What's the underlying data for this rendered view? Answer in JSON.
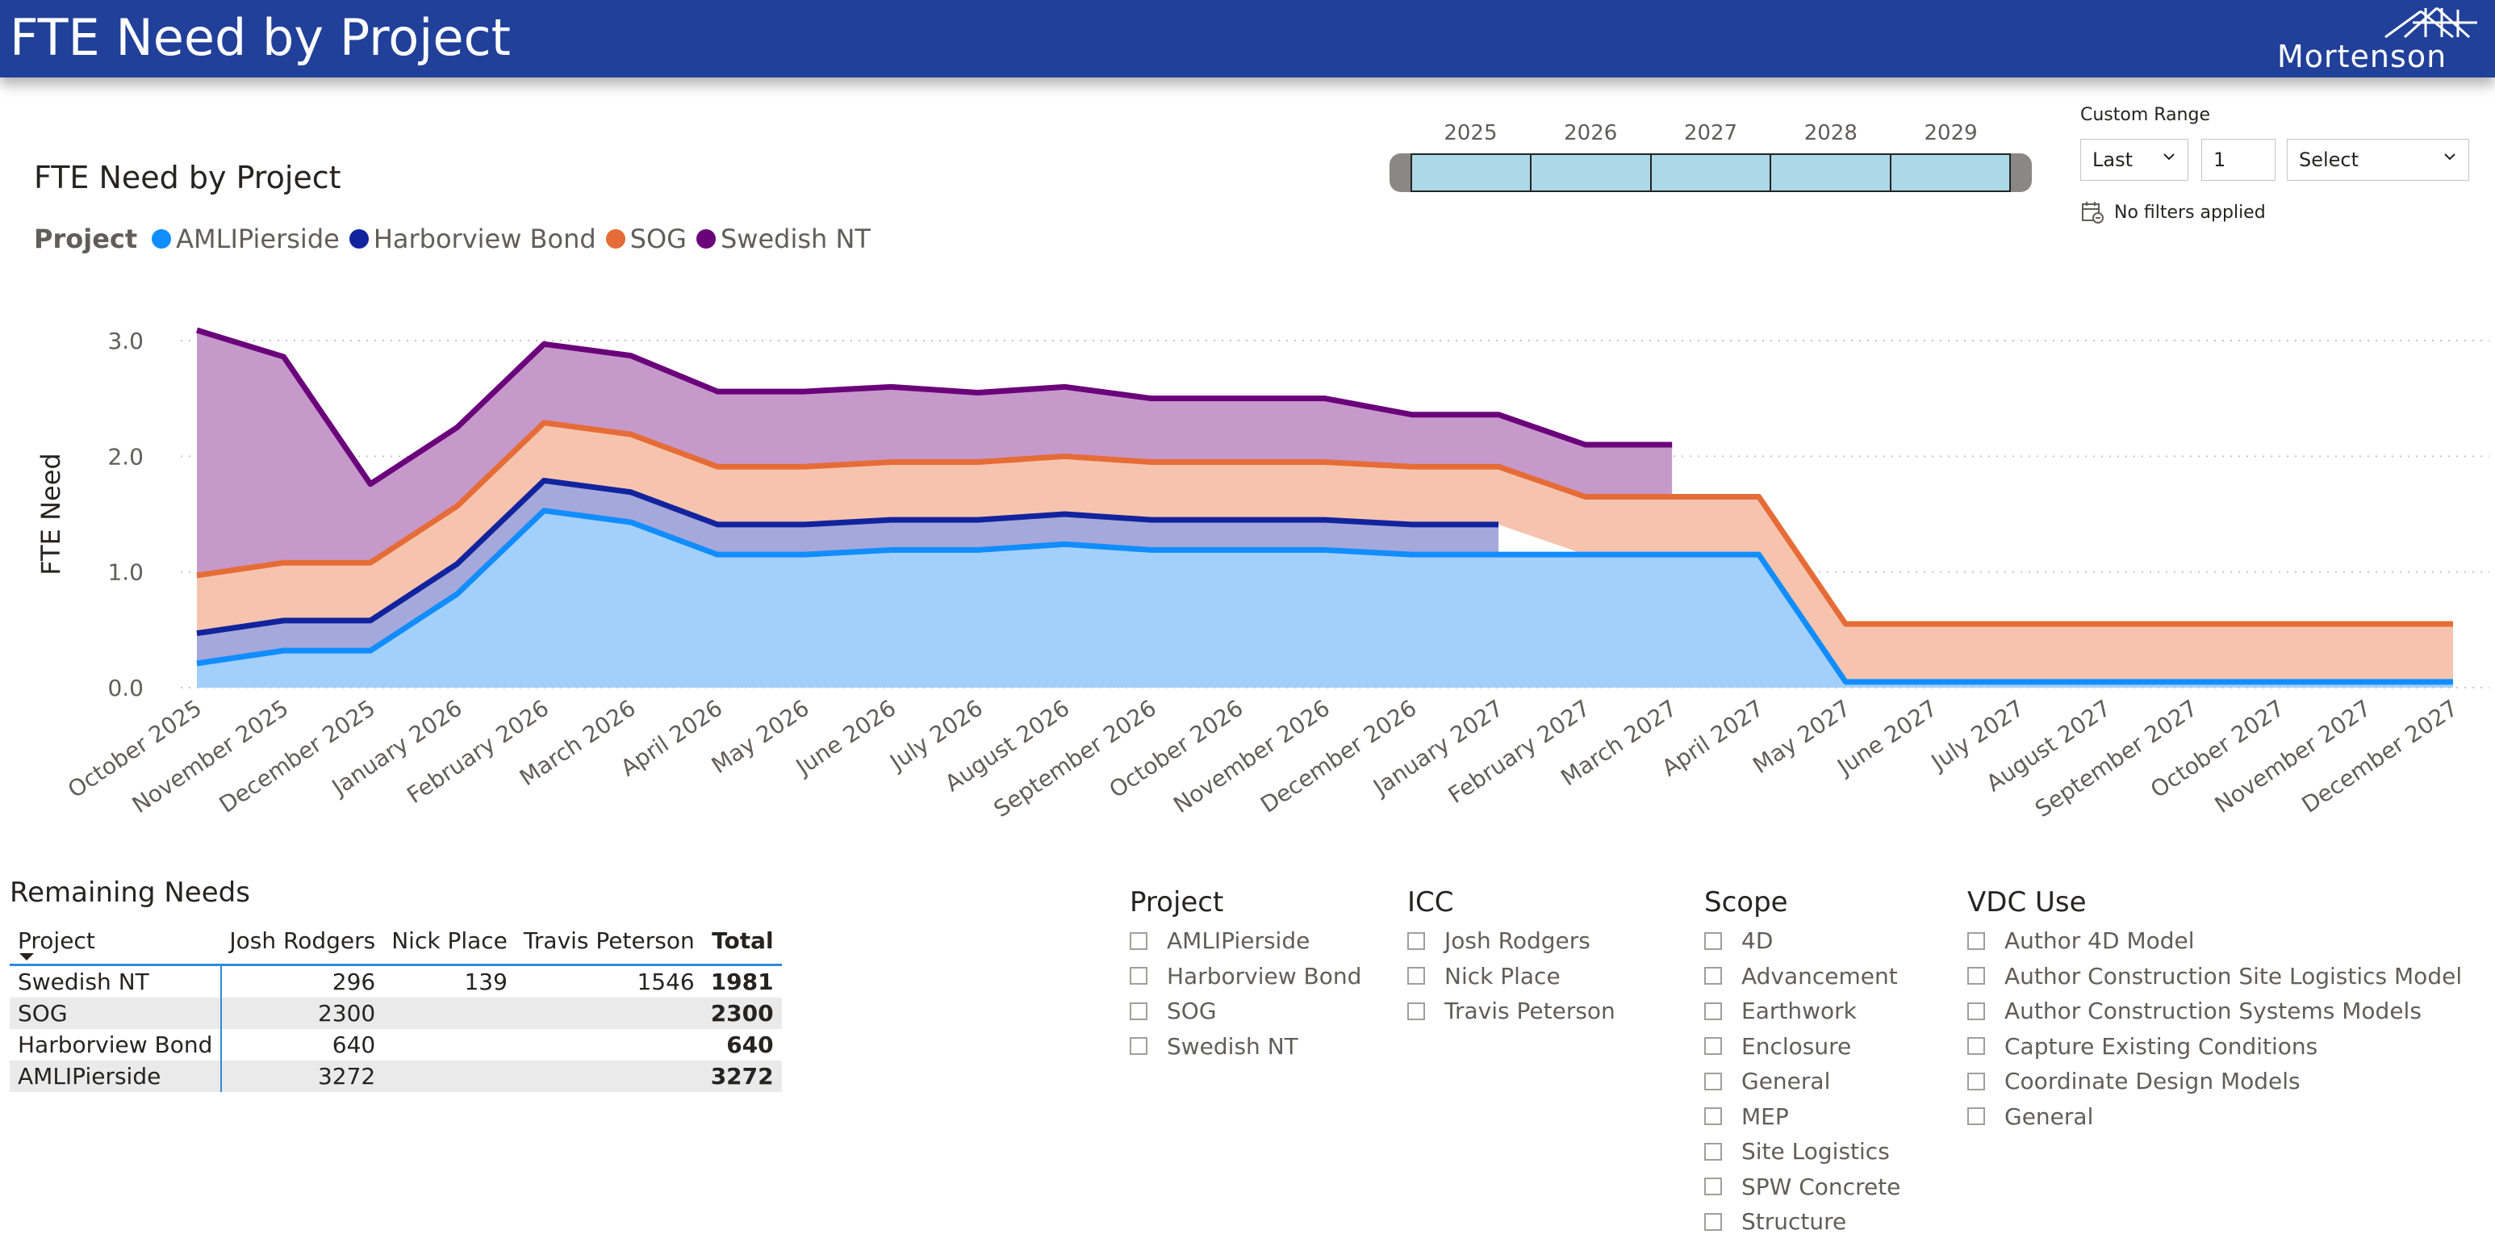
{
  "header": {
    "title": "FTE Need by Project",
    "logo_text": "Mortenson",
    "bg_color": "#21409a"
  },
  "chart": {
    "title": "FTE Need by Project",
    "legend_title": "Project"
  },
  "chart_data": {
    "type": "area",
    "stacked": true,
    "ylabel": "FTE Need",
    "xlabel": "",
    "ylim": [
      0,
      3.0
    ],
    "yticks": [
      "0.0",
      "1.0",
      "2.0",
      "3.0"
    ],
    "grid": true,
    "legend_position": "top-left",
    "categories": [
      "October 2025",
      "November 2025",
      "December 2025",
      "January 2026",
      "February 2026",
      "March 2026",
      "April 2026",
      "May 2026",
      "June 2026",
      "July 2026",
      "August 2026",
      "September 2026",
      "October 2026",
      "November 2026",
      "December 2026",
      "January 2027",
      "February 2027",
      "March 2027",
      "April 2027",
      "May 2027",
      "June 2027",
      "July 2027",
      "August 2027",
      "September 2027",
      "October 2027",
      "November 2027",
      "December 2027"
    ],
    "series": [
      {
        "name": "AMLIPierside",
        "color": "#118dff",
        "fill": "#a3d0fb",
        "values": [
          0.21,
          0.32,
          0.32,
          0.81,
          1.53,
          1.43,
          1.15,
          1.15,
          1.19,
          1.19,
          1.24,
          1.19,
          1.19,
          1.19,
          1.15,
          1.15,
          1.15,
          1.15,
          1.15,
          0.05,
          0.05,
          0.05,
          0.05,
          0.05,
          0.05,
          0.05,
          0.05
        ]
      },
      {
        "name": "Harborview Bond",
        "color": "#12239e",
        "fill": "#a5a8da",
        "values": [
          0.26,
          0.26,
          0.26,
          0.26,
          0.26,
          0.26,
          0.26,
          0.26,
          0.26,
          0.26,
          0.26,
          0.26,
          0.26,
          0.26,
          0.26,
          0.26,
          null,
          null,
          null,
          null,
          null,
          null,
          null,
          null,
          null,
          null,
          null
        ]
      },
      {
        "name": "SOG",
        "color": "#e66c37",
        "fill": "#f6c4ae",
        "values": [
          0.5,
          0.5,
          0.5,
          0.5,
          0.5,
          0.5,
          0.5,
          0.5,
          0.5,
          0.5,
          0.5,
          0.5,
          0.5,
          0.5,
          0.5,
          0.5,
          0.5,
          0.5,
          0.5,
          0.5,
          0.5,
          0.5,
          0.5,
          0.5,
          0.5,
          0.5,
          0.5
        ]
      },
      {
        "name": "Swedish NT",
        "color": "#6b007b",
        "fill": "#c699cb",
        "values": [
          2.12,
          1.78,
          0.68,
          0.68,
          0.68,
          0.68,
          0.65,
          0.65,
          0.65,
          0.6,
          0.6,
          0.55,
          0.55,
          0.55,
          0.45,
          0.45,
          0.45,
          0.45,
          null,
          null,
          null,
          null,
          null,
          null,
          null,
          null,
          null
        ]
      }
    ]
  },
  "timeline": {
    "years": [
      "2025",
      "2026",
      "2027",
      "2028",
      "2029"
    ]
  },
  "custom_range": {
    "label": "Custom Range",
    "mode_value": "Last",
    "count_value": "1",
    "period_value": "Select",
    "status": "No filters applied"
  },
  "remaining_needs": {
    "title": "Remaining Needs",
    "columns": [
      "Project",
      "Josh Rodgers",
      "Nick Place",
      "Travis Peterson",
      "Total"
    ],
    "rows": [
      [
        "Swedish NT",
        "296",
        "139",
        "1546",
        "1981"
      ],
      [
        "SOG",
        "2300",
        "",
        "",
        "2300"
      ],
      [
        "Harborview Bond",
        "640",
        "",
        "",
        "640"
      ],
      [
        "AMLIPierside",
        "3272",
        "",
        "",
        "3272"
      ]
    ]
  },
  "slicers": {
    "project": {
      "title": "Project",
      "items": [
        "AMLIPierside",
        "Harborview Bond",
        "SOG",
        "Swedish NT"
      ]
    },
    "icc": {
      "title": "ICC",
      "items": [
        "Josh Rodgers",
        "Nick Place",
        "Travis Peterson"
      ]
    },
    "scope": {
      "title": "Scope",
      "items": [
        "4D",
        "Advancement",
        "Earthwork",
        "Enclosure",
        "General",
        "MEP",
        "Site Logistics",
        "SPW Concrete",
        "Structure"
      ]
    },
    "vdc_use": {
      "title": "VDC Use",
      "items": [
        "Author 4D Model",
        "Author Construction Site Logistics Model",
        "Author Construction Systems Models",
        "Capture Existing Conditions",
        "Coordinate Design Models",
        "General"
      ]
    }
  }
}
